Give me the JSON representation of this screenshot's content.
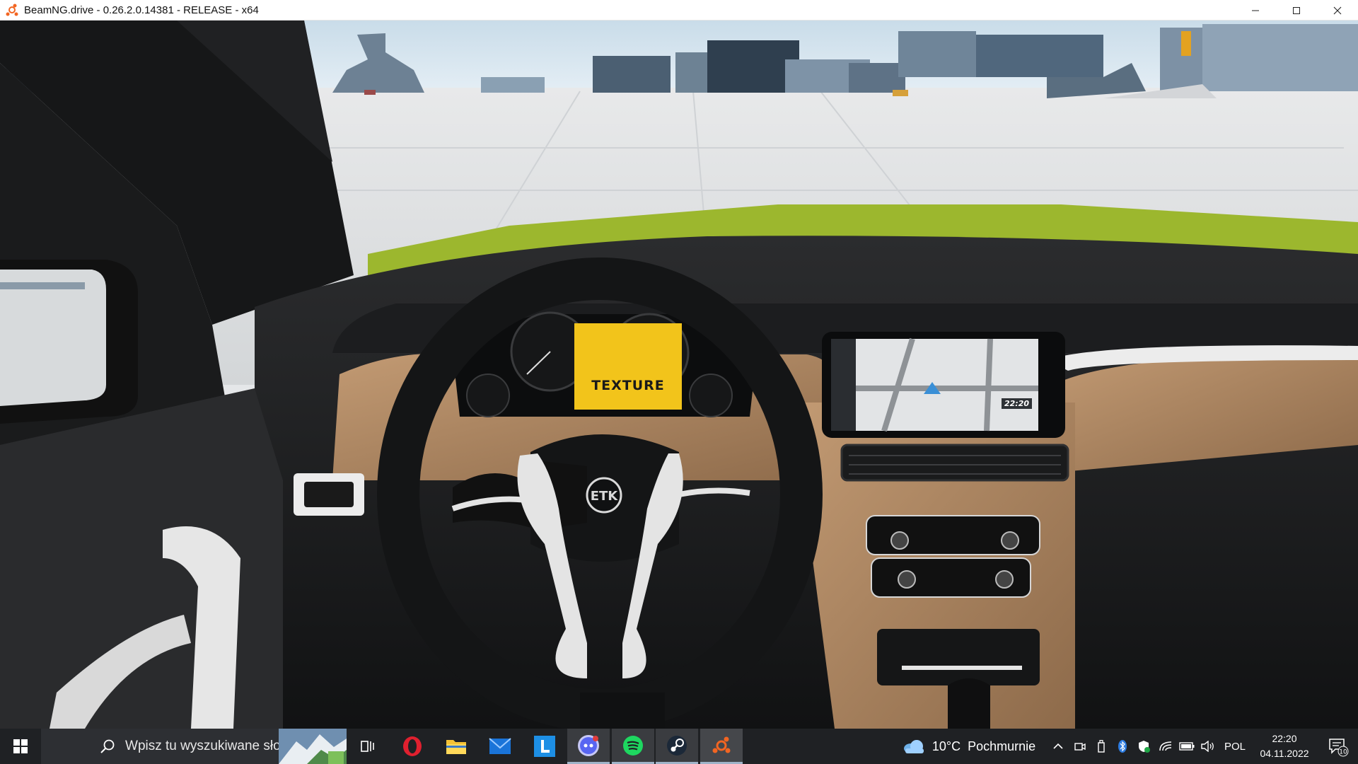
{
  "window": {
    "title": "BeamNG.drive - 0.26.2.0.14381 - RELEASE - x64",
    "controls": [
      "minimize",
      "maximize",
      "close"
    ]
  },
  "game": {
    "dashboard_texture_label": "TEXTURE",
    "steering_badge": "ETK",
    "nav_clock": "22:20",
    "accent_color": "#9cb72e"
  },
  "taskbar": {
    "search_placeholder": "Wpisz tu wyszukiwane słowa",
    "pinned_apps": [
      "task-view",
      "opera",
      "file-explorer",
      "mail",
      "l-app",
      "discord",
      "spotify",
      "steam",
      "beamng"
    ],
    "weather_temp": "10°C",
    "weather_desc": "Pochmurnie",
    "language": "POL",
    "time": "22:20",
    "date": "04.11.2022",
    "notification_count": "10"
  }
}
